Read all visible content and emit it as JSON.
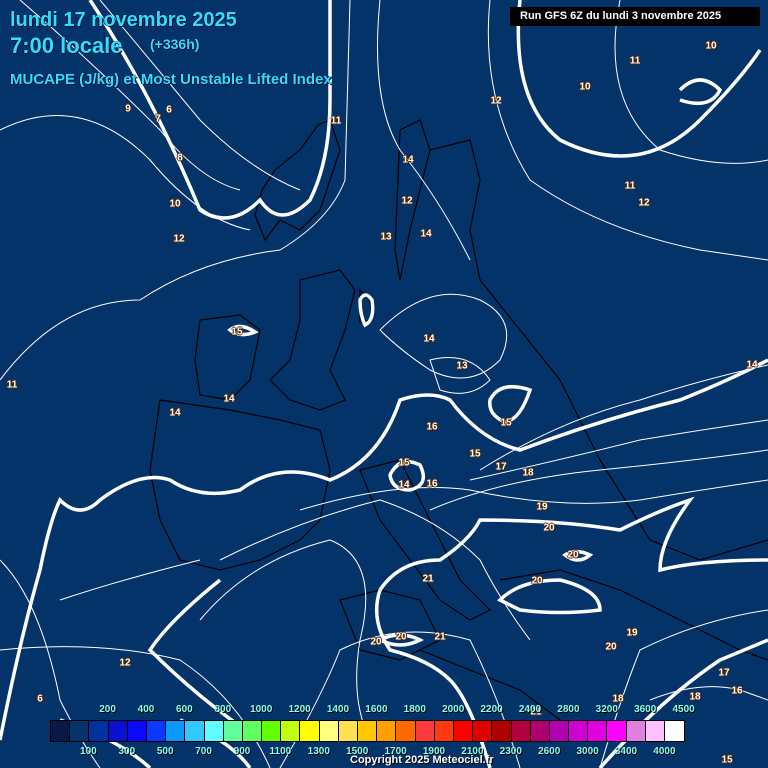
{
  "header": {
    "date": "lundi 17 novembre 2025",
    "time": "7:00 locale",
    "lead": "(+336h)",
    "parameter": "MUCAPE (J/kg) et Most Unstable Lifted Index",
    "run": "Run GFS 6Z du lundi 3 novembre 2025"
  },
  "contour_labels": [
    "6",
    "7",
    "9",
    "8",
    "10",
    "12",
    "11",
    "14",
    "12",
    "13",
    "14",
    "12",
    "10",
    "11",
    "10",
    "11",
    "12",
    "15",
    "14",
    "13",
    "11",
    "14",
    "14",
    "16",
    "15",
    "15",
    "15",
    "17",
    "18",
    "14",
    "16",
    "19",
    "20",
    "20",
    "20",
    "21",
    "20",
    "20",
    "21",
    "19",
    "20",
    "12",
    "17",
    "16",
    "18",
    "18",
    "14",
    "6",
    "15",
    "21"
  ],
  "legend": {
    "colors": [
      "#0a1848",
      "#073468",
      "#0033a0",
      "#0a10d0",
      "#0a0aff",
      "#0a3aff",
      "#0a9aff",
      "#30c8ff",
      "#60ffff",
      "#60ff9a",
      "#60ff60",
      "#60ff00",
      "#c0ff10",
      "#ffff00",
      "#ffff80",
      "#ffe050",
      "#ffc800",
      "#ffa000",
      "#ff6a00",
      "#ff3a3a",
      "#ff3a10",
      "#ff0000",
      "#e00000",
      "#b00000",
      "#b00040",
      "#b00070",
      "#b000b0",
      "#d000d0",
      "#e000e0",
      "#ff00ff",
      "#e080e0",
      "#ffc0ff",
      "#ffffff"
    ],
    "top_labels": [
      "200",
      "400",
      "600",
      "800",
      "1000",
      "1200",
      "1400",
      "1600",
      "1800",
      "2000",
      "2200",
      "2400",
      "2800",
      "3200",
      "3600",
      "4500"
    ],
    "bottom_labels": [
      "100",
      "300",
      "500",
      "700",
      "900",
      "1100",
      "1300",
      "1500",
      "1700",
      "1900",
      "2100",
      "2300",
      "2600",
      "3000",
      "3400",
      "4000"
    ]
  },
  "copyright": "Copyright 2025 Meteociel.fr"
}
